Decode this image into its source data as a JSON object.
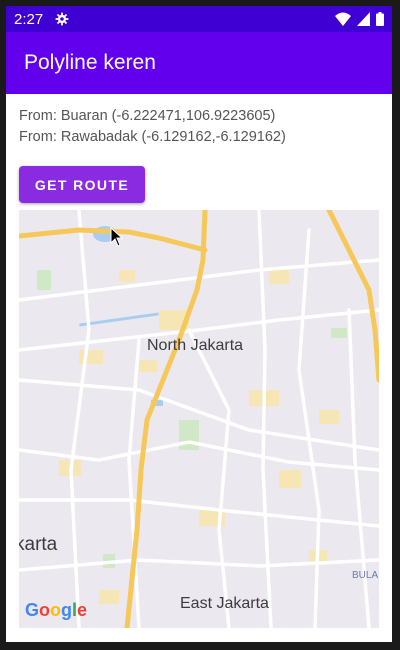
{
  "status_bar": {
    "time": "2:27",
    "icons": [
      "gear-icon",
      "wifi-icon",
      "signal-icon",
      "battery-icon"
    ],
    "color": "#3f00d3"
  },
  "app_bar": {
    "title": "Polyline keren",
    "color": "#6200ee"
  },
  "content": {
    "from_line_1": "From: Buaran (-6.222471,106.9223605)",
    "from_line_2": "From: Rawabadak (-6.129162,-6.129162)",
    "button_label": "GET ROUTE",
    "button_color": "#8a2be2"
  },
  "map": {
    "labels": {
      "north_jakarta": "North Jakarta",
      "karta": "karta",
      "east_jakarta": "East Jakarta",
      "bula": "BULA"
    },
    "logo": "Google",
    "road_color": "#f6c85a",
    "background_color": "#ece8ef"
  }
}
